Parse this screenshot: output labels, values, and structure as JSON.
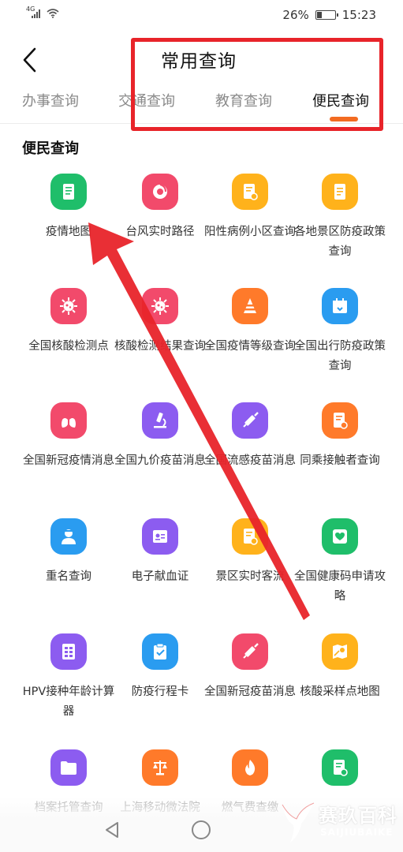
{
  "status_bar": {
    "signal_label": "4G",
    "battery_percent": "26%",
    "battery_level": 0.26,
    "time": "15:23"
  },
  "header": {
    "title": "常用查询",
    "back_icon": "chevron-left-icon"
  },
  "tabs": [
    {
      "label": "办事查询",
      "active": false
    },
    {
      "label": "交通查询",
      "active": false
    },
    {
      "label": "教育查询",
      "active": false
    },
    {
      "label": "便民查询",
      "active": true
    }
  ],
  "section": {
    "title": "便民查询"
  },
  "colors": {
    "accent": "#f36b21",
    "highlight_box": "#e8242a",
    "arrow": "#e8242a"
  },
  "items": [
    {
      "label": "疫情地图",
      "icon": "map-document-icon",
      "color": "#1fbe6a"
    },
    {
      "label": "台风实时路径",
      "icon": "typhoon-icon",
      "color": "#f24a6b"
    },
    {
      "label": "阳性病例小区查询",
      "icon": "document-search-icon",
      "color": "#ffb21b"
    },
    {
      "label": "各地景区防疫政策查询",
      "icon": "document-icon",
      "color": "#ffb21b"
    },
    {
      "label": "全国核酸检测点",
      "icon": "virus-icon",
      "color": "#f24a6b"
    },
    {
      "label": "核酸检测结果查询",
      "icon": "virus-icon",
      "color": "#f24a6b"
    },
    {
      "label": "全国疫情等级查询",
      "icon": "cone-icon",
      "color": "#ff7a2a"
    },
    {
      "label": "全国出行防疫政策查询",
      "icon": "calendar-icon",
      "color": "#2a9cf0"
    },
    {
      "label": "全国新冠疫情消息",
      "icon": "lungs-icon",
      "color": "#f24a6b"
    },
    {
      "label": "全国九价疫苗消息",
      "icon": "microscope-icon",
      "color": "#8c5cf0"
    },
    {
      "label": "全国流感疫苗消息",
      "icon": "syringe-icon",
      "color": "#8c5cf0"
    },
    {
      "label": "同乘接触者查询",
      "icon": "document-search-icon",
      "color": "#ff7a2a"
    },
    {
      "label": "重名查询",
      "icon": "person-icon",
      "color": "#2a9cf0"
    },
    {
      "label": "电子献血证",
      "icon": "id-card-icon",
      "color": "#8c5cf0"
    },
    {
      "label": "景区实时客流",
      "icon": "document-search-icon",
      "color": "#ffb21b"
    },
    {
      "label": "全国健康码申请攻略",
      "icon": "health-shield-icon",
      "color": "#1fbe6a"
    },
    {
      "label": "HPV接种年龄计算器",
      "icon": "calculator-icon",
      "color": "#8c5cf0"
    },
    {
      "label": "防疫行程卡",
      "icon": "clipboard-check-icon",
      "color": "#2a9cf0"
    },
    {
      "label": "全国新冠疫苗消息",
      "icon": "syringe-icon",
      "color": "#f24a6b"
    },
    {
      "label": "核酸采样点地图",
      "icon": "map-pin-icon",
      "color": "#ffb21b"
    },
    {
      "label": "档案托管查询",
      "icon": "folder-icon",
      "color": "#8c5cf0"
    },
    {
      "label": "上海移动微法院",
      "icon": "scales-icon",
      "color": "#ff7a2a"
    },
    {
      "label": "燃气费查缴",
      "icon": "flame-icon",
      "color": "#ff7a2a"
    },
    {
      "label": "",
      "icon": "document-search-icon",
      "color": "#1fbe6a"
    }
  ],
  "watermark": {
    "text": "赛玖百科",
    "sub": "SAIJIUBAIKE"
  }
}
